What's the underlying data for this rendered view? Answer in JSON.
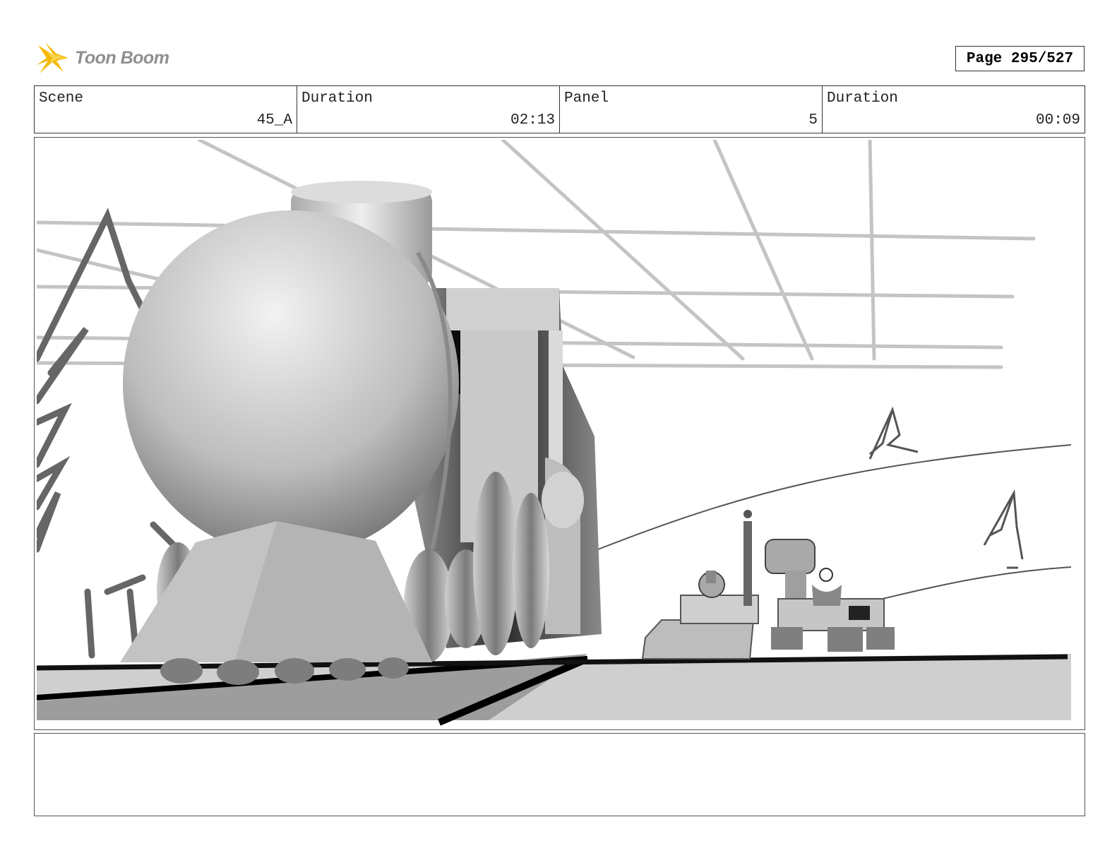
{
  "header": {
    "brand": "Toon Boom",
    "page_label": "Page 295/527"
  },
  "info": {
    "scene_label": "Scene",
    "scene_value": "45_A",
    "scene_duration_label": "Duration",
    "scene_duration_value": "02:13",
    "panel_label": "Panel",
    "panel_value": "5",
    "panel_duration_label": "Duration",
    "panel_duration_value": "00:09"
  },
  "notes": {
    "text": ""
  },
  "colors": {
    "logo_accent": "#f5b800",
    "border": "#333333"
  }
}
